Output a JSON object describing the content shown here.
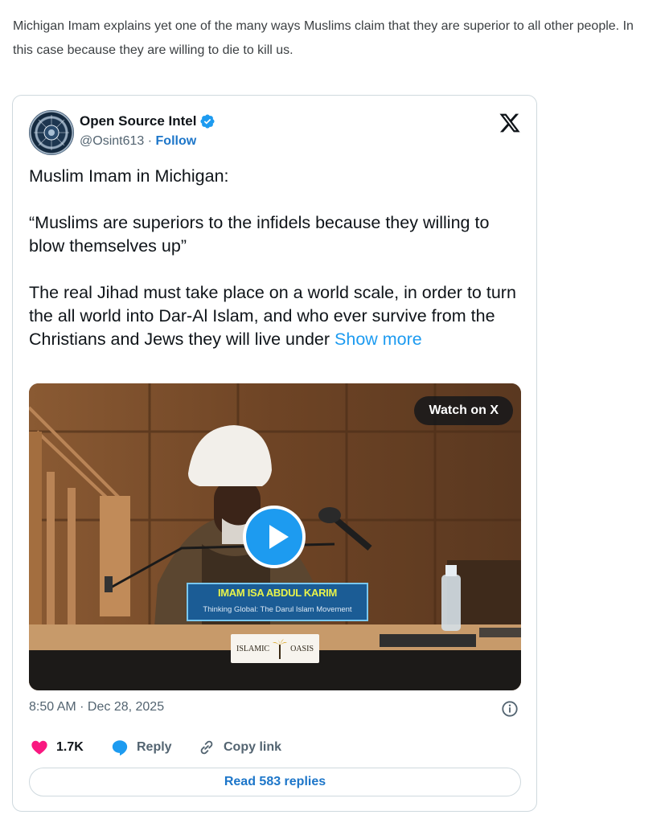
{
  "post": {
    "text": "Michigan Imam explains yet one of the many ways Muslims claim that they are superior to all other people. In this case because they are willing to die to kill us."
  },
  "tweet": {
    "author": {
      "name": "Open Source Intel",
      "handle": "@Osint613",
      "separator": "·",
      "follow_label": "Follow",
      "verified_icon": "verified-badge-icon"
    },
    "platform_icon": "x-logo-icon",
    "body": {
      "line1": "Muslim Imam in Michigan:",
      "quote": "“Muslims are superiors to the infidels because they willing to blow themselves up”",
      "para3": "The real Jihad must take place on a world scale, in order to turn the all world into Dar-Al Islam, and who ever survive from the Christians and Jews they will live under",
      "show_more": "Show more"
    },
    "media": {
      "watch_label": "Watch on X",
      "lower_third_name": "IMAM ISA ABDUL KARIM",
      "lower_third_subtitle": "Thinking Global: The Darul Islam Movement",
      "logo_left": "ISLAMIC",
      "logo_right": "OASIS"
    },
    "timestamp": "8:50 AM · Dec 28, 2025",
    "actions": {
      "likes": "1.7K",
      "reply_label": "Reply",
      "copy_label": "Copy link"
    },
    "read_replies": "Read 583 replies"
  },
  "colors": {
    "link": "#1d9bf0",
    "like": "#f91880",
    "verified": "#1d9bf0",
    "reply_button_text": "#1d76c9"
  }
}
